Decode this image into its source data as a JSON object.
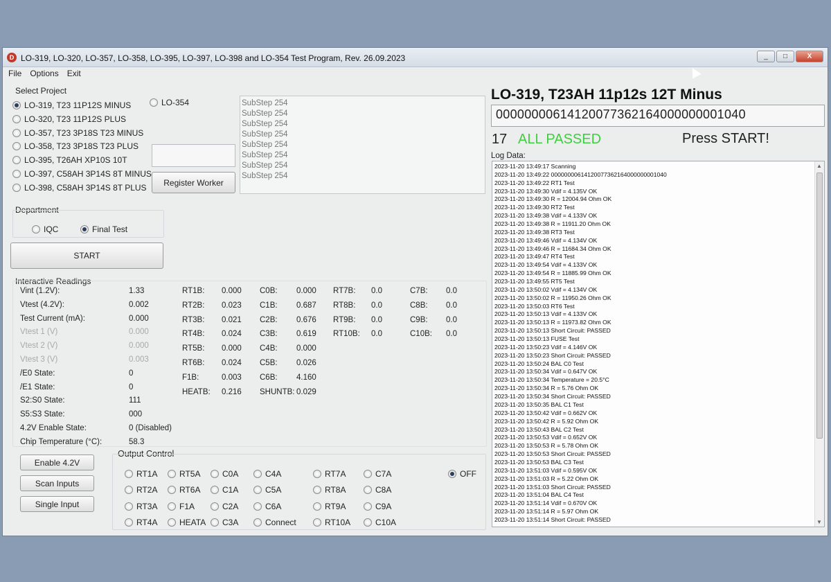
{
  "window": {
    "title": "LO-319, LO-320, LO-357, LO-358, LO-395, LO-397, LO-398 and LO-354 Test Program, Rev. 26.09.2023",
    "icon_letter": "D",
    "controls": {
      "minimize": "_",
      "maximize": "□",
      "close": "X"
    }
  },
  "menu": [
    "File",
    "Options",
    "Exit"
  ],
  "select_project": {
    "label": "Select Project",
    "options": [
      {
        "label": "LO-319, T23 11P12S MINUS",
        "selected": true
      },
      {
        "label": "LO-320, T23 11P12S PLUS",
        "selected": false
      },
      {
        "label": "LO-357, T23 3P18S T23 MINUS",
        "selected": false
      },
      {
        "label": "LO-358, T23 3P18S T23 PLUS",
        "selected": false
      },
      {
        "label": "LO-395, T26AH XP10S 10T",
        "selected": false
      },
      {
        "label": "LO-397, C58AH 3P14S 8T MINUS",
        "selected": false
      },
      {
        "label": "LO-398, C58AH 3P14S 8T PLUS",
        "selected": false
      }
    ],
    "extra_option": "LO-354"
  },
  "worker": {
    "input_value": "",
    "register_button": "Register Worker"
  },
  "substeps": [
    "SubStep 254",
    "SubStep 254",
    "SubStep 254",
    "SubStep 254",
    "SubStep 254",
    "SubStep 254",
    "SubStep 254",
    "SubStep 254"
  ],
  "department": {
    "label": "Department",
    "options": [
      {
        "label": "IQC",
        "selected": false
      },
      {
        "label": "Final Test",
        "selected": true
      }
    ]
  },
  "start_button": "START",
  "interactive": {
    "label": "Interactive Readings",
    "rows": [
      {
        "label": "Vint (1.2V):",
        "value": "1.33",
        "faded": false
      },
      {
        "label": "Vtest (4.2V):",
        "value": "0.002",
        "faded": false
      },
      {
        "label": "Test Current (mA):",
        "value": "0.000",
        "faded": false
      },
      {
        "label": "Vtest 1 (V)",
        "value": "0.000",
        "faded": true
      },
      {
        "label": "Vtest 2 (V)",
        "value": "0.000",
        "faded": true
      },
      {
        "label": "Vtest 3 (V)",
        "value": "0.003",
        "faded": true
      },
      {
        "label": "/E0 State:",
        "value": "0",
        "faded": false
      },
      {
        "label": "/E1 State:",
        "value": "0",
        "faded": false
      },
      {
        "label": "S2:S0 State:",
        "value": "111",
        "faded": false
      },
      {
        "label": "S5:S3 State:",
        "value": "000",
        "faded": false
      },
      {
        "label": "4.2V Enable State:",
        "value": "0 (Disabled)",
        "faded": false
      },
      {
        "label": "Chip Temperature (°C):",
        "value": "58.3",
        "faded": false
      }
    ],
    "col1": [
      {
        "label": "RT1B:",
        "value": "0.000"
      },
      {
        "label": "RT2B:",
        "value": "0.023"
      },
      {
        "label": "RT3B:",
        "value": "0.021"
      },
      {
        "label": "RT4B:",
        "value": "0.024"
      },
      {
        "label": "RT5B:",
        "value": "0.000"
      },
      {
        "label": "RT6B:",
        "value": "0.024"
      },
      {
        "label": "F1B:",
        "value": "0.003"
      },
      {
        "label": "HEATB:",
        "value": "0.216"
      }
    ],
    "col2": [
      {
        "label": "C0B:",
        "value": "0.000"
      },
      {
        "label": "C1B:",
        "value": "0.687"
      },
      {
        "label": "C2B:",
        "value": "0.676"
      },
      {
        "label": "C3B:",
        "value": "0.619"
      },
      {
        "label": "C4B:",
        "value": "0.000"
      },
      {
        "label": "C5B:",
        "value": "0.026"
      },
      {
        "label": "C6B:",
        "value": "4.160"
      },
      {
        "label": "SHUNTB:",
        "value": "0.029"
      }
    ],
    "col3": [
      {
        "label": "RT7B:",
        "value": "0.0"
      },
      {
        "label": "RT8B:",
        "value": "0.0"
      },
      {
        "label": "RT9B:",
        "value": "0.0"
      },
      {
        "label": "RT10B:",
        "value": "0.0"
      }
    ],
    "col4": [
      {
        "label": "C7B:",
        "value": "0.0"
      },
      {
        "label": "C8B:",
        "value": "0.0"
      },
      {
        "label": "C9B:",
        "value": "0.0"
      },
      {
        "label": "C10B:",
        "value": "0.0"
      }
    ]
  },
  "left_buttons": [
    "Enable 4.2V",
    "Scan Inputs",
    "Single Input"
  ],
  "output_control": {
    "label": "Output Control",
    "columns": [
      [
        "RT1A",
        "RT2A",
        "RT3A",
        "RT4A"
      ],
      [
        "RT5A",
        "RT6A",
        "F1A",
        "HEATA"
      ],
      [
        "C0A",
        "C1A",
        "C2A",
        "C3A"
      ],
      [
        "C4A",
        "C5A",
        "C6A",
        "Connect"
      ],
      [
        "RT7A",
        "RT8A",
        "RT9A",
        "RT10A"
      ],
      [
        "C7A",
        "C8A",
        "C9A",
        "C10A"
      ]
    ],
    "off_label": "OFF",
    "off_selected": true
  },
  "right": {
    "product_title": "LO-319, T23AH 11p12s 12T Minus",
    "serial": "00000000614120077362164000000001040",
    "count": "17",
    "status": "ALL PASSED",
    "status_color": "#3ecf3e",
    "prompt": "Press START!",
    "log_label": "Log Data:",
    "log": [
      "2023-11-20 13:49:17 Scanning",
      "2023-11-20 13:49:22 00000000614120077362164000000001040",
      "2023-11-20 13:49:22 RT1 Test",
      "2023-11-20 13:49:30 Vdif = 4.135V OK",
      "2023-11-20 13:49:30 R = 12004.94 Ohm OK",
      "2023-11-20 13:49:30 RT2 Test",
      "2023-11-20 13:49:38 Vdif = 4.133V OK",
      "2023-11-20 13:49:38 R = 11911.20 Ohm OK",
      "2023-11-20 13:49:38 RT3 Test",
      "2023-11-20 13:49:46 Vdif = 4.134V OK",
      "2023-11-20 13:49:46 R = 11684.34 Ohm OK",
      "2023-11-20 13:49:47 RT4 Test",
      "2023-11-20 13:49:54 Vdif = 4.133V OK",
      "2023-11-20 13:49:54 R = 11885.99 Ohm OK",
      "2023-11-20 13:49:55 RT5 Test",
      "2023-11-20 13:50:02 Vdif = 4.134V OK",
      "2023-11-20 13:50:02 R = 11950.26 Ohm OK",
      "2023-11-20 13:50:03 RT6 Test",
      "2023-11-20 13:50:13 Vdif = 4.133V OK",
      "2023-11-20 13:50:13 R = 11973.82 Ohm OK",
      "2023-11-20 13:50:13 Short Circuit: PASSED",
      "2023-11-20 13:50:13 FUSE Test",
      "2023-11-20 13:50:23 Vdif = 4.146V OK",
      "2023-11-20 13:50:23 Short Circuit: PASSED",
      "2023-11-20 13:50:24 BAL C0 Test",
      "2023-11-20 13:50:34 Vdif = 0.647V OK",
      "2023-11-20 13:50:34 Temperature = 20.5°C",
      "2023-11-20 13:50:34 R = 5.76 Ohm OK",
      "2023-11-20 13:50:34 Short Circuit: PASSED",
      "2023-11-20 13:50:35 BAL C1 Test",
      "2023-11-20 13:50:42 Vdif = 0.662V OK",
      "2023-11-20 13:50:42 R = 5.92 Ohm OK",
      "2023-11-20 13:50:43 BAL C2 Test",
      "2023-11-20 13:50:53 Vdif = 0.652V OK",
      "2023-11-20 13:50:53 R = 5.78 Ohm OK",
      "2023-11-20 13:50:53 Short Circuit: PASSED",
      "2023-11-20 13:50:53 BAL C3 Test",
      "2023-11-20 13:51:03 Vdif = 0.595V OK",
      "2023-11-20 13:51:03 R = 5.22 Ohm OK",
      "2023-11-20 13:51:03 Short Circuit: PASSED",
      "2023-11-20 13:51:04 BAL C4 Test",
      "2023-11-20 13:51:14 Vdif = 0.670V OK",
      "2023-11-20 13:51:14 R = 5.97 Ohm OK",
      "2023-11-20 13:51:14 Short Circuit: PASSED"
    ]
  }
}
